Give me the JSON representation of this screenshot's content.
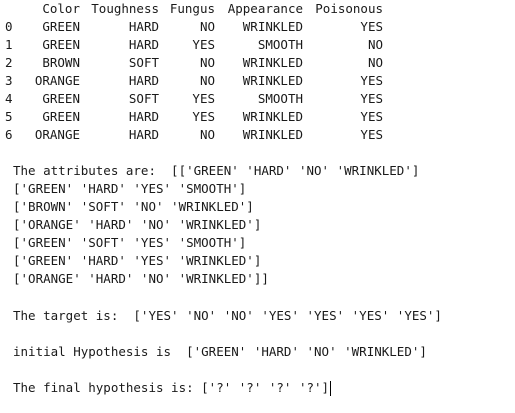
{
  "dataframe": {
    "columns": [
      "Color",
      "Toughness",
      "Fungus",
      "Appearance",
      "Poisonous"
    ],
    "rows": [
      {
        "index": "0",
        "cells": [
          "GREEN",
          "HARD",
          "NO",
          "WRINKLED",
          "YES"
        ]
      },
      {
        "index": "1",
        "cells": [
          "GREEN",
          "HARD",
          "YES",
          "SMOOTH",
          "NO"
        ]
      },
      {
        "index": "2",
        "cells": [
          "BROWN",
          "SOFT",
          "NO",
          "WRINKLED",
          "NO"
        ]
      },
      {
        "index": "3",
        "cells": [
          "ORANGE",
          "HARD",
          "NO",
          "WRINKLED",
          "YES"
        ]
      },
      {
        "index": "4",
        "cells": [
          "GREEN",
          "SOFT",
          "YES",
          "SMOOTH",
          "YES"
        ]
      },
      {
        "index": "5",
        "cells": [
          "GREEN",
          "HARD",
          "YES",
          "WRINKLED",
          "YES"
        ]
      },
      {
        "index": "6",
        "cells": [
          "ORANGE",
          "HARD",
          "NO",
          "WRINKLED",
          "YES"
        ]
      }
    ]
  },
  "output": {
    "attributes_lines": [
      "The attributes are:  [['GREEN' 'HARD' 'NO' 'WRINKLED']",
      "['GREEN' 'HARD' 'YES' 'SMOOTH']",
      "['BROWN' 'SOFT' 'NO' 'WRINKLED']",
      "['ORANGE' 'HARD' 'NO' 'WRINKLED']",
      "['GREEN' 'SOFT' 'YES' 'SMOOTH']",
      "['GREEN' 'HARD' 'YES' 'WRINKLED']",
      "['ORANGE' 'HARD' 'NO' 'WRINKLED']]"
    ],
    "target_line": "The target is:  ['YES' 'NO' 'NO' 'YES' 'YES' 'YES' 'YES']",
    "initial_hypothesis_line": "initial Hypothesis is  ['GREEN' 'HARD' 'NO' 'WRINKLED']",
    "final_hypothesis_line": "The final hypothesis is: ['?' '?' '?' '?']"
  }
}
